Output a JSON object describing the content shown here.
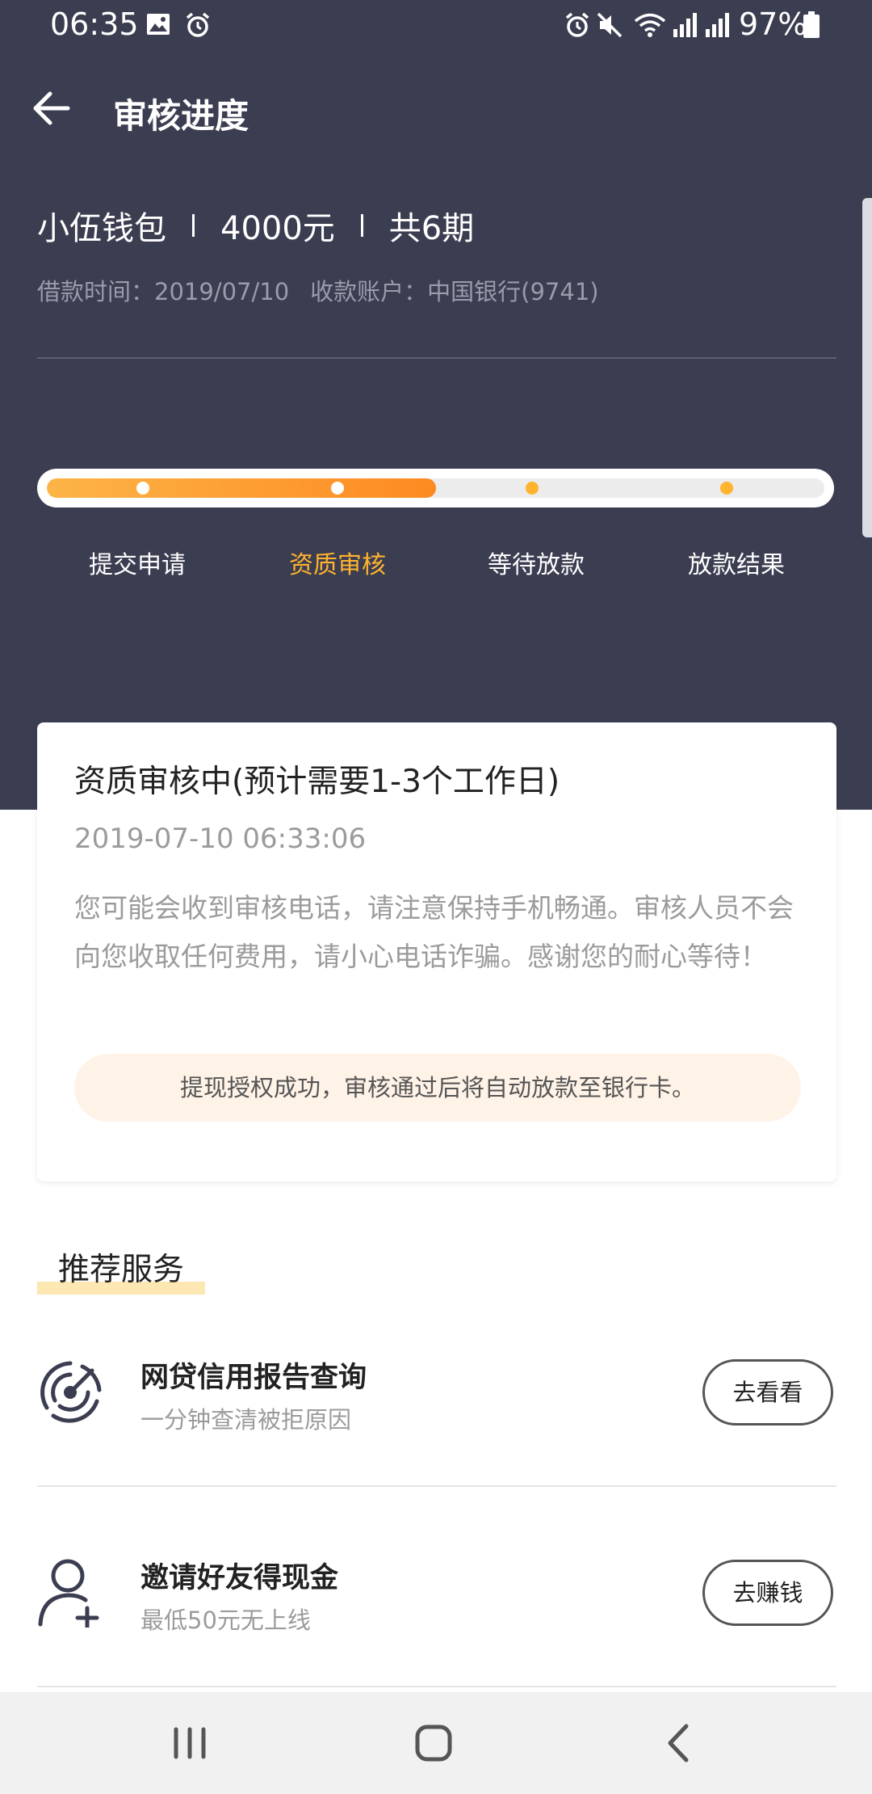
{
  "status_bar": {
    "time": "06:35",
    "battery": "97%"
  },
  "header": {
    "title": "审核进度"
  },
  "summary": {
    "product": "小伍钱包",
    "amount": "4000元",
    "periods": "共6期",
    "loan_time": "借款时间：2019/07/10",
    "account": "收款账户：中国银行(9741)"
  },
  "progress": {
    "fraction": 0.5,
    "steps": [
      {
        "label": "提交申请",
        "state": "done"
      },
      {
        "label": "资质审核",
        "state": "active"
      },
      {
        "label": "等待放款",
        "state": "pending"
      },
      {
        "label": "放款结果",
        "state": "pending"
      }
    ]
  },
  "status_card": {
    "title": "资质审核中(预计需要1-3个工作日)",
    "time": "2019-07-10 06:33:06",
    "description": "您可能会收到审核电话，请注意保持手机畅通。审核人员不会向您收取任何费用，请小心电话诈骗。感谢您的耐心等待！",
    "notice": "提现授权成功，审核通过后将自动放款至银行卡。"
  },
  "recommended": {
    "title": "推荐服务",
    "items": [
      {
        "icon": "radar-icon",
        "title": "网贷信用报告查询",
        "subtitle": "一分钟查清被拒原因",
        "button": "去看看"
      },
      {
        "icon": "add-user-icon",
        "title": "邀请好友得现金",
        "subtitle": "最低50元无上线",
        "button": "去赚钱"
      }
    ]
  },
  "colors": {
    "header_bg": "#3b3d51",
    "accent": "#ffb32e",
    "progress_start": "#fdb447",
    "progress_end": "#fd8a21",
    "notice_bg": "#fff3e8"
  }
}
